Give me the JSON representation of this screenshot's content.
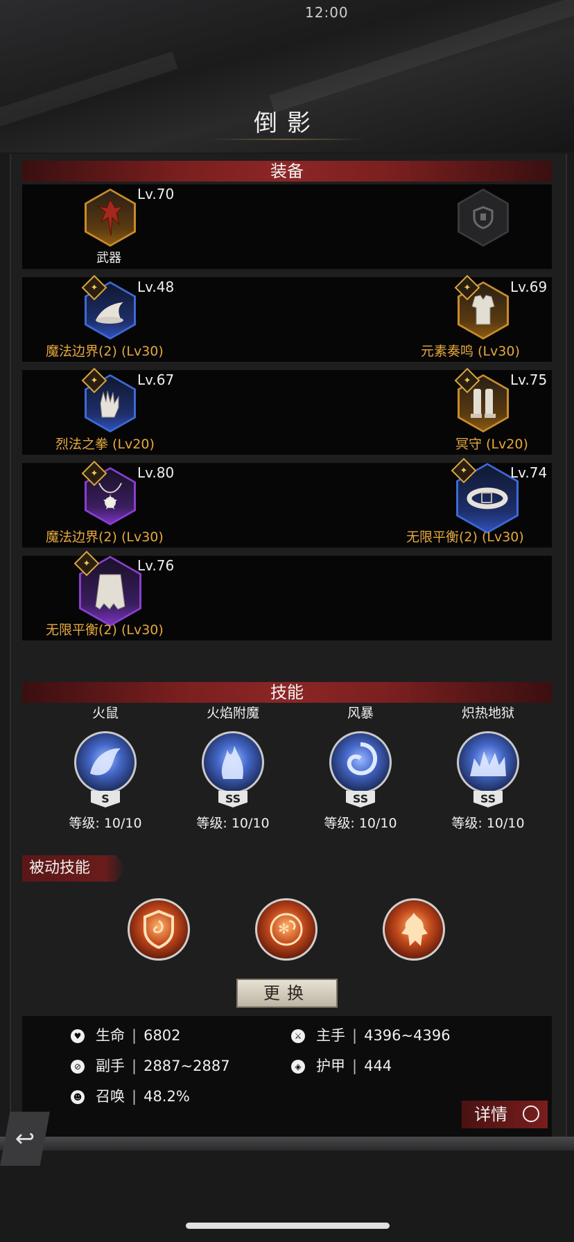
{
  "status": {
    "time": "12:00"
  },
  "title": "倒影",
  "equipment": {
    "header": "装备",
    "weapon": {
      "level": "Lv.70",
      "label": "武器"
    },
    "rows": [
      {
        "left": {
          "level": "Lv.48",
          "set": "魔法边界(2)  (Lv30)"
        },
        "right": {
          "level": "Lv.69",
          "set": "元素奏鸣  (Lv30)"
        }
      },
      {
        "left": {
          "level": "Lv.67",
          "set": "烈法之拳  (Lv20)"
        },
        "right": {
          "level": "Lv.75",
          "set": "冥守  (Lv20)"
        }
      },
      {
        "left": {
          "level": "Lv.80",
          "set": "魔法边界(2)  (Lv30)"
        },
        "right": {
          "level": "Lv.74",
          "set": "无限平衡(2)  (Lv30)"
        }
      },
      {
        "left": {
          "level": "Lv.76",
          "set": "无限平衡(2)  (Lv30)"
        }
      }
    ]
  },
  "skills": {
    "header": "技能",
    "items": [
      {
        "name": "火鼠",
        "rank": "S",
        "level": "等级: 10/10"
      },
      {
        "name": "火焰附魔",
        "rank": "SS",
        "level": "等级: 10/10"
      },
      {
        "name": "风暴",
        "rank": "SS",
        "level": "等级: 10/10"
      },
      {
        "name": "炽热地狱",
        "rank": "SS",
        "level": "等级: 10/10"
      }
    ]
  },
  "passive": {
    "header": "被动技能",
    "swap_label": "更换"
  },
  "stats": {
    "hp_label": "生命",
    "hp_value": "6802",
    "main_label": "主手",
    "main_value": "4396~4396",
    "off_label": "副手",
    "off_value": "2887~2887",
    "armor_label": "护甲",
    "armor_value": "444",
    "summon_label": "召唤",
    "summon_value": "48.2%",
    "detail_label": "详情"
  }
}
